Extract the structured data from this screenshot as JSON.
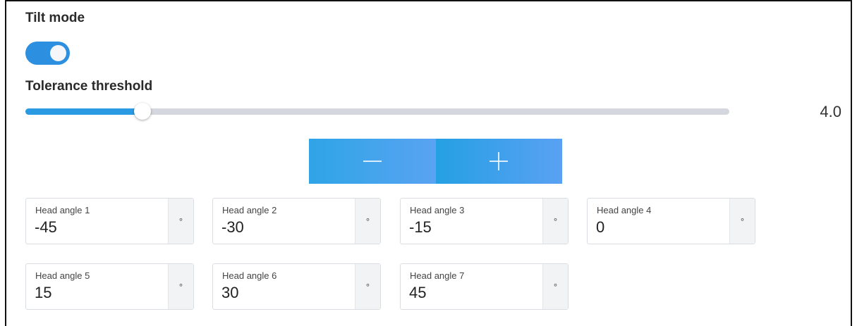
{
  "tilt_mode": {
    "label": "Tilt mode",
    "enabled": true
  },
  "tolerance": {
    "label": "Tolerance threshold",
    "value_text": "4.0",
    "fraction": 0.166
  },
  "stepper": {
    "minus_icon": "minus-icon",
    "plus_icon": "plus-icon"
  },
  "head_angles": [
    {
      "label": "Head angle 1",
      "value": "-45",
      "unit": "°"
    },
    {
      "label": "Head angle 2",
      "value": "-30",
      "unit": "°"
    },
    {
      "label": "Head angle 3",
      "value": "-15",
      "unit": "°"
    },
    {
      "label": "Head angle 4",
      "value": "0",
      "unit": "°"
    },
    {
      "label": "Head angle 5",
      "value": "15",
      "unit": "°"
    },
    {
      "label": "Head angle 6",
      "value": "30",
      "unit": "°"
    },
    {
      "label": "Head angle 7",
      "value": "45",
      "unit": "°"
    }
  ],
  "colors": {
    "accent": "#2d8fe0",
    "track": "#d4d7dd"
  }
}
